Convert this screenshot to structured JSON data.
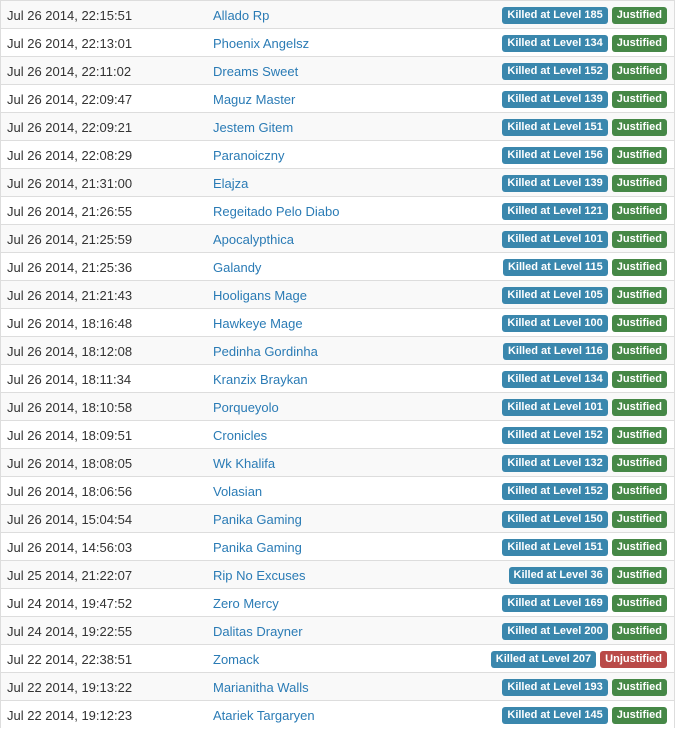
{
  "colors": {
    "level_badge": "#3a87ad",
    "justified_badge": "#468847",
    "unjustified_badge": "#b94a48",
    "link": "#2a7bb5"
  },
  "kills": [
    {
      "date": "Jul 26 2014, 22:15:51",
      "victim": "Allado Rp",
      "level_text": "Killed at Level 185",
      "status": "Justified"
    },
    {
      "date": "Jul 26 2014, 22:13:01",
      "victim": "Phoenix Angelsz",
      "level_text": "Killed at Level 134",
      "status": "Justified"
    },
    {
      "date": "Jul 26 2014, 22:11:02",
      "victim": "Dreams Sweet",
      "level_text": "Killed at Level 152",
      "status": "Justified"
    },
    {
      "date": "Jul 26 2014, 22:09:47",
      "victim": "Maguz Master",
      "level_text": "Killed at Level 139",
      "status": "Justified"
    },
    {
      "date": "Jul 26 2014, 22:09:21",
      "victim": "Jestem Gitem",
      "level_text": "Killed at Level 151",
      "status": "Justified"
    },
    {
      "date": "Jul 26 2014, 22:08:29",
      "victim": "Paranoiczny",
      "level_text": "Killed at Level 156",
      "status": "Justified"
    },
    {
      "date": "Jul 26 2014, 21:31:00",
      "victim": "Elajza",
      "level_text": "Killed at Level 139",
      "status": "Justified"
    },
    {
      "date": "Jul 26 2014, 21:26:55",
      "victim": "Regeitado Pelo Diabo",
      "level_text": "Killed at Level 121",
      "status": "Justified"
    },
    {
      "date": "Jul 26 2014, 21:25:59",
      "victim": "Apocalypthica",
      "level_text": "Killed at Level 101",
      "status": "Justified"
    },
    {
      "date": "Jul 26 2014, 21:25:36",
      "victim": "Galandy",
      "level_text": "Killed at Level 115",
      "status": "Justified"
    },
    {
      "date": "Jul 26 2014, 21:21:43",
      "victim": "Hooligans Mage",
      "level_text": "Killed at Level 105",
      "status": "Justified"
    },
    {
      "date": "Jul 26 2014, 18:16:48",
      "victim": "Hawkeye Mage",
      "level_text": "Killed at Level 100",
      "status": "Justified"
    },
    {
      "date": "Jul 26 2014, 18:12:08",
      "victim": "Pedinha Gordinha",
      "level_text": "Killed at Level 116",
      "status": "Justified"
    },
    {
      "date": "Jul 26 2014, 18:11:34",
      "victim": "Kranzix Braykan",
      "level_text": "Killed at Level 134",
      "status": "Justified"
    },
    {
      "date": "Jul 26 2014, 18:10:58",
      "victim": "Porqueyolo",
      "level_text": "Killed at Level 101",
      "status": "Justified"
    },
    {
      "date": "Jul 26 2014, 18:09:51",
      "victim": "Cronicles",
      "level_text": "Killed at Level 152",
      "status": "Justified"
    },
    {
      "date": "Jul 26 2014, 18:08:05",
      "victim": "Wk Khalifa",
      "level_text": "Killed at Level 132",
      "status": "Justified"
    },
    {
      "date": "Jul 26 2014, 18:06:56",
      "victim": "Volasian",
      "level_text": "Killed at Level 152",
      "status": "Justified"
    },
    {
      "date": "Jul 26 2014, 15:04:54",
      "victim": "Panika Gaming",
      "level_text": "Killed at Level 150",
      "status": "Justified"
    },
    {
      "date": "Jul 26 2014, 14:56:03",
      "victim": "Panika Gaming",
      "level_text": "Killed at Level 151",
      "status": "Justified"
    },
    {
      "date": "Jul 25 2014, 21:22:07",
      "victim": "Rip No Excuses",
      "level_text": "Killed at Level 36",
      "status": "Justified"
    },
    {
      "date": "Jul 24 2014, 19:47:52",
      "victim": "Zero Mercy",
      "level_text": "Killed at Level 169",
      "status": "Justified"
    },
    {
      "date": "Jul 24 2014, 19:22:55",
      "victim": "Dalitas Drayner",
      "level_text": "Killed at Level 200",
      "status": "Justified"
    },
    {
      "date": "Jul 22 2014, 22:38:51",
      "victim": "Zomack",
      "level_text": "Killed at Level 207",
      "status": "Unjustified"
    },
    {
      "date": "Jul 22 2014, 19:13:22",
      "victim": "Marianitha Walls",
      "level_text": "Killed at Level 193",
      "status": "Justified"
    },
    {
      "date": "Jul 22 2014, 19:12:23",
      "victim": "Atariek Targaryen",
      "level_text": "Killed at Level 145",
      "status": "Justified"
    }
  ]
}
